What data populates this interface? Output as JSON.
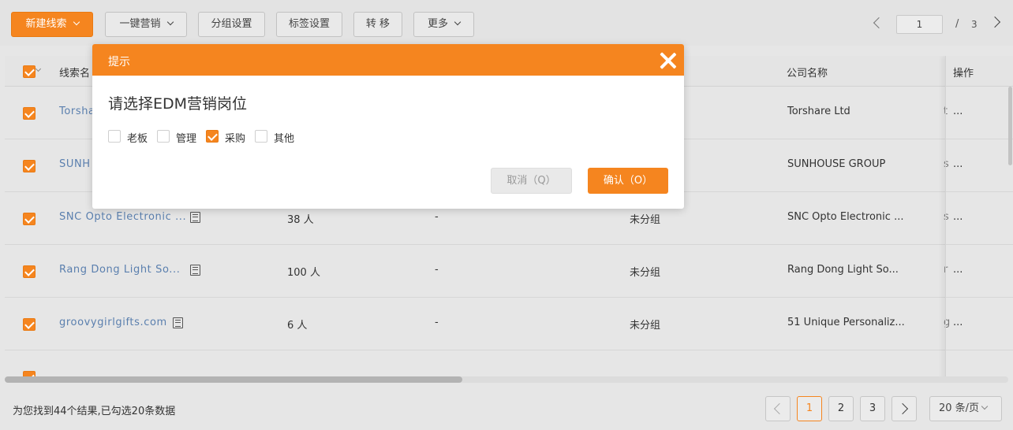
{
  "toolbar": {
    "new_lead": "新建线索",
    "marketing": "一键营销",
    "group_settings": "分组设置",
    "tag_settings": "标签设置",
    "transfer": "转 移",
    "more": "更多",
    "current_page": "1",
    "slash": "/",
    "total_pages": "3"
  },
  "table": {
    "headers": {
      "name": "线索名",
      "company": "公司名称",
      "actions": "操作"
    },
    "rows": [
      {
        "name": "Torsha",
        "size": "",
        "tag": "",
        "group": "",
        "company": "Torshare Ltd",
        "extra": "t",
        "actions": "..."
      },
      {
        "name": "SUNH",
        "size": "",
        "tag": "",
        "group": "",
        "company": "SUNHOUSE GROUP",
        "extra": "s",
        "actions": "..."
      },
      {
        "name": "SNC Opto Electronic ...",
        "size": "38 人",
        "tag": "-",
        "group": "未分组",
        "company": "SNC Opto Electronic ...",
        "extra": "s",
        "actions": "..."
      },
      {
        "name": "Rang Dong Light So...",
        "size": "100 人",
        "tag": "-",
        "group": "未分组",
        "company": "Rang Dong Light So...",
        "extra": "r",
        "actions": "..."
      },
      {
        "name": "groovygirlgifts.com",
        "size": "6 人",
        "tag": "-",
        "group": "未分组",
        "company": "51 Unique Personaliz...",
        "extra": "g",
        "actions": "..."
      }
    ]
  },
  "footer": {
    "summary": "为您找到44个结果,已勾选20条数据",
    "pages": [
      "1",
      "2",
      "3"
    ],
    "page_size": "20 条/页"
  },
  "modal": {
    "title": "提示",
    "question": "请选择EDM营销岗位",
    "options": [
      {
        "label": "老板",
        "checked": false
      },
      {
        "label": "管理",
        "checked": false
      },
      {
        "label": "采购",
        "checked": true
      },
      {
        "label": "其他",
        "checked": false
      }
    ],
    "cancel": "取消（Q）",
    "confirm": "确认（O）"
  },
  "colors": {
    "accent": "#f5851f",
    "link": "#5a7fae"
  }
}
